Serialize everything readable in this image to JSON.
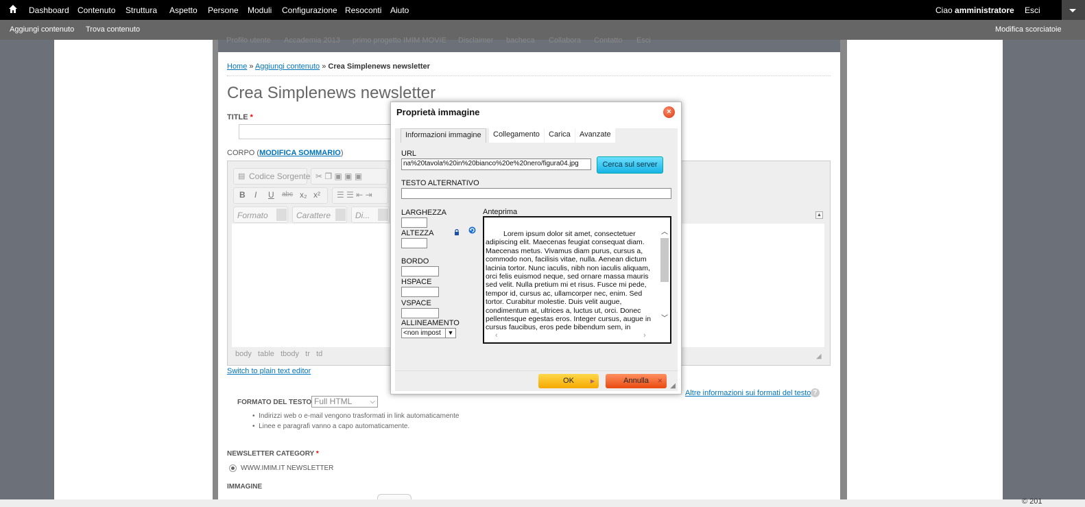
{
  "admin_bar": {
    "items": [
      "Dashboard",
      "Contenuto",
      "Struttura",
      "Aspetto",
      "Persone",
      "Moduli",
      "Configurazione",
      "Resoconti",
      "Aiuto"
    ],
    "greeting_prefix": "Ciao ",
    "user": "amministratore",
    "logout": "Esci"
  },
  "shortcut_bar": {
    "items": [
      "Aggiungi contenuto",
      "Trova contenuto"
    ],
    "edit_shortcuts": "Modifica scorciatoie"
  },
  "site_nav": [
    "Profilo utente",
    "Accademia 2013",
    "primo progetto IMIM MOVIE",
    "Disclaimer",
    "bacheca",
    "Collabora",
    "Contatto",
    "Esci"
  ],
  "breadcrumb": {
    "home": "Home",
    "sep": " » ",
    "add": "Aggiungi contenuto",
    "current": "Crea Simplenews newsletter"
  },
  "page_title": "Crea Simplenews newsletter",
  "form": {
    "title_label": "TITLE",
    "required_mark": "*",
    "body_label": "CORPO (",
    "body_link": "MODIFICA SOMMARIO",
    "body_label_end": ")",
    "switch_editor": "Switch to plain text editor",
    "format_label": "FORMATO DEL TESTO",
    "format_value": "Full HTML",
    "format_more": "Altre informazioni sui formati del testo",
    "format_tips": [
      "Indirizzi web o e-mail vengono trasformati in link automaticamente",
      "Linee e paragrafi vanno a capo automaticamente."
    ],
    "category_label": "NEWSLETTER CATEGORY",
    "category_option": "WWW.IMIM.IT NEWSLETTER",
    "image_label": "IMMAGINE"
  },
  "editor": {
    "source_button": "Codice Sorgente",
    "format_combo": "Formato",
    "font_combo": "Carattere",
    "size_combo": "Di...",
    "path": [
      "body",
      "table",
      "tbody",
      "tr",
      "td"
    ]
  },
  "dialog": {
    "title": "Proprietà immagine",
    "close": "×",
    "tabs": [
      "Informazioni immagine",
      "Collegamento",
      "Carica",
      "Avanzate"
    ],
    "url_label": "URL",
    "url_value": "na%20tavola%20in%20bianco%20e%20nero/figura04.jpg",
    "browse_button": "Cerca sul server",
    "alt_label": "TESTO ALTERNATIVO",
    "alt_value": "",
    "width_label": "LARGHEZZA",
    "height_label": "ALTEZZA",
    "border_label": "BORDO",
    "hspace_label": "HSPACE",
    "vspace_label": "VSPACE",
    "align_label": "ALLINEAMENTO",
    "align_value": "<non impost",
    "preview_label": "Anteprima",
    "preview_text": "Lorem ipsum dolor sit amet, consectetuer adipiscing elit. Maecenas feugiat consequat diam. Maecenas metus. Vivamus diam purus, cursus a, commodo non, facilisis vitae, nulla. Aenean dictum lacinia tortor. Nunc iaculis, nibh non iaculis aliquam, orci felis euismod neque, sed ornare massa mauris sed velit. Nulla pretium mi et risus. Fusce mi pede, tempor id, cursus ac, ullamcorper nec, enim. Sed tortor. Curabitur molestie. Duis velit augue, condimentum at, ultrices a, luctus ut, orci. Donec pellentesque egestas eros. Integer cursus, augue in cursus faucibus, eros pede bibendum sem, in",
    "ok": "OK",
    "cancel": "Annulla"
  },
  "footer": {
    "copyright": "© 201"
  },
  "colors": {
    "admin_bar": "#000000",
    "shortcut_bar": "#666666",
    "link": "#0074bd",
    "ok": "#f5a800",
    "cancel": "#e84a10",
    "browse": "#19b3e6"
  }
}
